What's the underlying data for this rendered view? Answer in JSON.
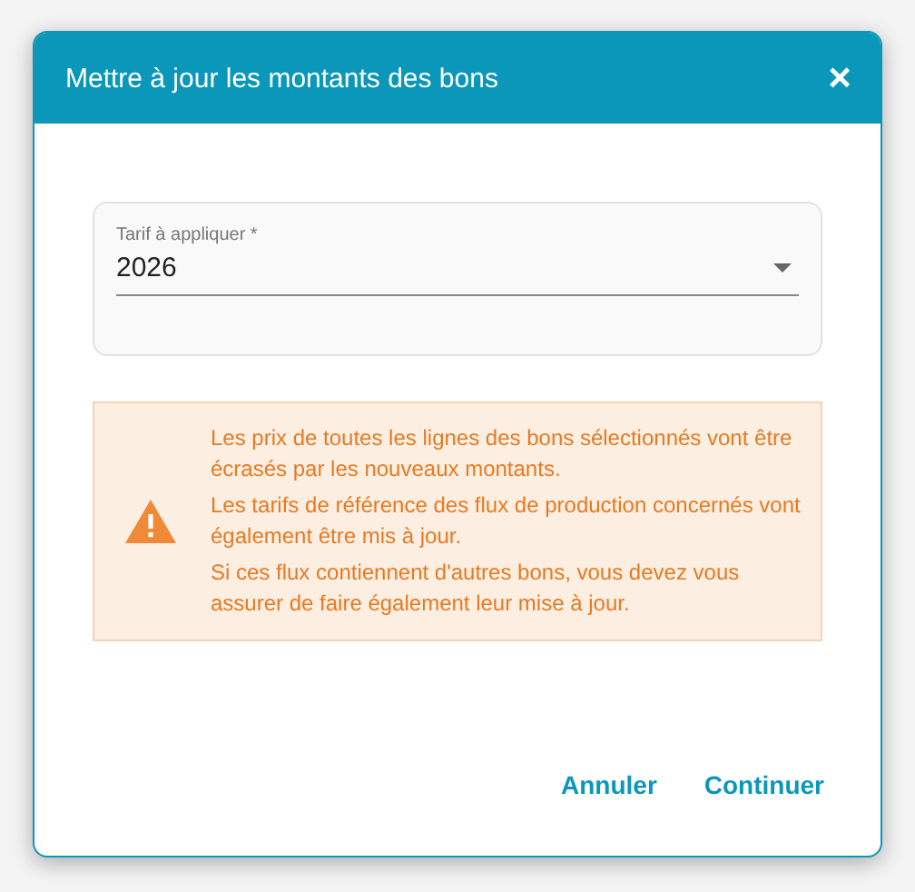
{
  "dialog": {
    "title": "Mettre à jour les montants des bons",
    "close": "×"
  },
  "field": {
    "label": "Tarif à appliquer *",
    "value": "2026"
  },
  "warning": {
    "paragraphs": [
      "Les prix de toutes les lignes des bons sélectionnés vont être écrasés par les nouveaux montants.",
      "Les tarifs de référence des flux de production concernés vont également être mis à jour.",
      "Si ces flux contiennent d'autres bons, vous devez vous assurer de faire également leur mise à jour."
    ]
  },
  "buttons": [
    "Annuler",
    "Continuer"
  ]
}
